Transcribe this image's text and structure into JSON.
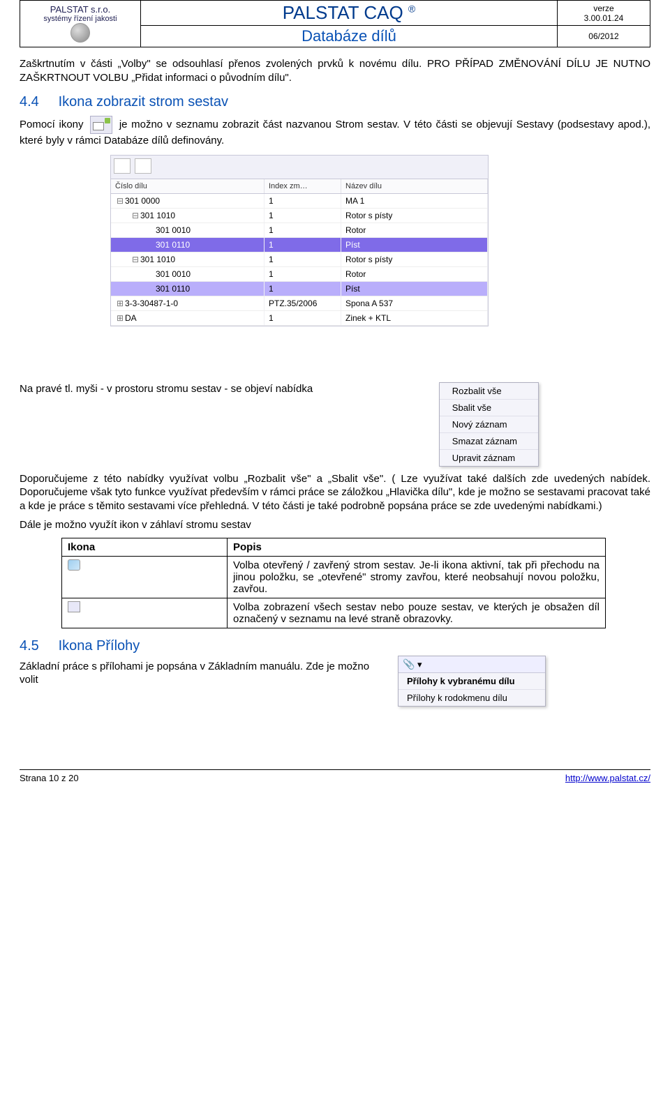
{
  "header": {
    "company": "PALSTAT s.r.o.",
    "company_sub": "systémy řízení jakosti",
    "app_name": "PALSTAT CAQ",
    "module": "Databáze dílů",
    "version_label": "verze",
    "version": "3.00.01.24",
    "date": "06/2012"
  },
  "intro": "Zaškrtnutím v části „Volby\" se odsouhlasí přenos zvolených prvků k novému dílu. PRO PŘÍPAD ZMĚNOVÁNÍ DÍLU JE NUTNO ZAŠKRTNOUT VOLBU „Přidat informaci o původním dílu\".",
  "sec44": {
    "num": "4.4",
    "title": "Ikona zobrazit strom sestav",
    "p1a": "Pomocí ikony ",
    "p1b": " je možno v seznamu zobrazit část nazvanou Strom sestav. V této části se objevují Sestavy (podsestavy apod.), které byly v rámci Databáze dílů definovány."
  },
  "tree": {
    "cols": [
      "Číslo dílu",
      "Index zm…",
      "Název dílu"
    ],
    "rows": [
      {
        "ind": 0,
        "tw": "⊟",
        "a": "301 0000",
        "b": "1",
        "c": "MA 1",
        "cls": ""
      },
      {
        "ind": 1,
        "tw": "⊟",
        "a": "301 1010",
        "b": "1",
        "c": "Rotor s písty",
        "cls": ""
      },
      {
        "ind": 2,
        "tw": "",
        "a": "301 0010",
        "b": "1",
        "c": "Rotor",
        "cls": ""
      },
      {
        "ind": 2,
        "tw": "",
        "a": "301 0110",
        "b": "1",
        "c": "Píst",
        "cls": "sel-strong"
      },
      {
        "ind": 1,
        "tw": "⊟",
        "a": "301 1010",
        "b": "1",
        "c": "Rotor s písty",
        "cls": ""
      },
      {
        "ind": 2,
        "tw": "",
        "a": "301 0010",
        "b": "1",
        "c": "Rotor",
        "cls": ""
      },
      {
        "ind": 2,
        "tw": "",
        "a": "301 0110",
        "b": "1",
        "c": "Píst",
        "cls": "sel"
      },
      {
        "ind": 0,
        "tw": "⊞",
        "a": "3-3-30487-1-0",
        "b": "PTZ.35/2006",
        "c": "Spona A 537",
        "cls": ""
      },
      {
        "ind": 0,
        "tw": "⊞",
        "a": "DA",
        "b": "1",
        "c": "Zinek + KTL",
        "cls": ""
      }
    ]
  },
  "ctx_menu": [
    "Rozbalit vše",
    "Sbalit vše",
    "Nový záznam",
    "Smazat záznam",
    "Upravit záznam"
  ],
  "sec44_p2a": "Na pravé tl. myši - v prostoru stromu sestav - se objeví nabídka ",
  "sec44_p2b": ".",
  "sec44_p3": "Doporučujeme z této nabídky využívat volbu „Rozbalit vše\" a „Sbalit vše\". ( Lze využívat také dalších zde uvedených nabídek. Doporučujeme však tyto funkce využívat především v rámci práce se záložkou „Hlavička dílu\", kde je možno se sestavami pracovat také a kde je práce s těmito sestavami více přehledná. V této části je také podrobně popsána práce se zde uvedenými nabídkami.)",
  "sec44_p4": "Dále je možno využít ikon v záhlaví stromu sestav",
  "icon_table": {
    "h1": "Ikona",
    "h2": "Popis",
    "r1_desc": "Volba otevřený / zavřený strom sestav. Je-li ikona aktivní, tak při přechodu na jinou položku, se „otevřené\" stromy zavřou, které neobsahují novou položku, zavřou.",
    "r2_desc": "Volba zobrazení všech sestav nebo pouze sestav, ve kterých je obsažen díl označený v seznamu na levé straně obrazovky."
  },
  "sec45": {
    "num": "4.5",
    "title": "Ikona Přílohy",
    "p1": "Základní práce s přílohami je popsána v Základním manuálu. Zde je možno volit"
  },
  "att_menu": {
    "items": [
      "Přílohy k vybranému dílu",
      "Přílohy k rodokmenu dílu"
    ]
  },
  "footer": {
    "left": "Strana 10 z 20",
    "right": "http://www.palstat.cz/"
  }
}
